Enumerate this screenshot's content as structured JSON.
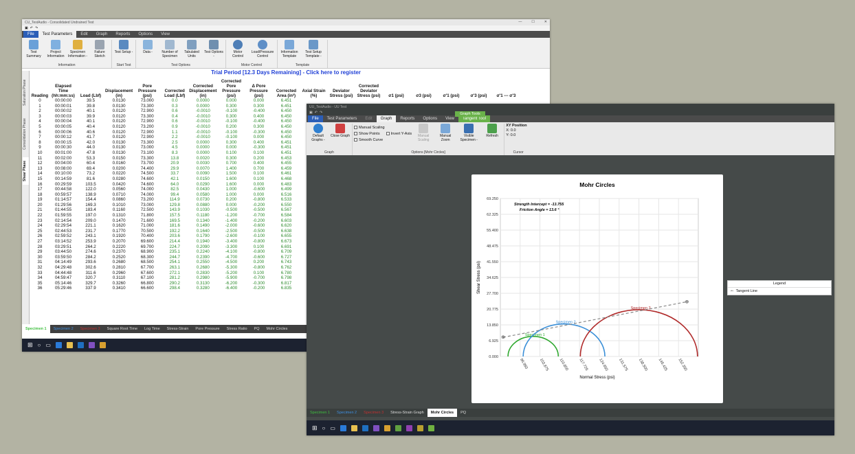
{
  "win1": {
    "title": "CU_TestAudio - Consolidated Undrained Test",
    "menu": [
      "File",
      "Test Parameters",
      "Edit",
      "Graph",
      "Reports",
      "Options",
      "View"
    ],
    "ribbon_groups": [
      {
        "label": "Information",
        "buttons": [
          "Test Summary",
          "Project Information",
          "Specimen Information -",
          "Failure Sketch"
        ]
      },
      {
        "label": "Start Test",
        "buttons": [
          "Test Setup -"
        ]
      },
      {
        "label": "Test Options",
        "buttons": [
          "Data -",
          "Number of Specimen",
          "Tabulated Units",
          "Test Options -"
        ]
      },
      {
        "label": "Motor Control",
        "buttons": [
          "Motor Control",
          "Load/Pressure Control"
        ]
      },
      {
        "label": "Template",
        "buttons": [
          "Information Template",
          "Test Setup Template -"
        ]
      }
    ],
    "trial_text": "Trial Period [12.3 Days Remaining] - Click here to register",
    "side_tabs": [
      "Saturation Phase",
      "Consolidation Phase",
      "Shear Phase"
    ],
    "columns": [
      "Reading",
      "Elapsed Time (hh:mm:ss)",
      "Load (Lbf)",
      "Displacement (in)",
      "Pore Pressure (psi)",
      "Corrected Load (Lbf)",
      "Corrected Displacement (in)",
      "Corrected Pore Pressure (psi)",
      "Δ Pore Pressure (psi)",
      "Corrected Area (in²)",
      "Axial Strain (%)",
      "Deviator Stress (psi)",
      "Corrected Deviator Stress (psi)",
      "σ1 (psi)",
      "σ3 (psi)",
      "σ'1 (psi)",
      "σ'3 (psi)",
      "σ'1 --- σ'3"
    ],
    "rows": [
      [
        "0",
        "00:00:00",
        "39.5",
        "0.0130",
        "73.000",
        "0.0",
        "0.0000",
        "0.000",
        "0.000",
        "6.451"
      ],
      [
        "1",
        "00:00:01",
        "39.8",
        "0.0130",
        "73.300",
        "0.3",
        "0.0000",
        "0.300",
        "0.300",
        "6.451"
      ],
      [
        "2",
        "00:00:02",
        "40.1",
        "0.0120",
        "72.900",
        "0.6",
        "-0.0010",
        "-0.100",
        "-0.400",
        "6.450"
      ],
      [
        "3",
        "00:00:03",
        "39.9",
        "0.0120",
        "73.300",
        "0.4",
        "-0.0010",
        "0.300",
        "0.400",
        "6.450"
      ],
      [
        "4",
        "00:00:04",
        "40.1",
        "0.0120",
        "72.900",
        "0.6",
        "-0.0010",
        "-0.100",
        "-0.400",
        "6.450"
      ],
      [
        "5",
        "00:00:05",
        "40.4",
        "0.0120",
        "73.200",
        "0.9",
        "-0.0010",
        "0.200",
        "0.300",
        "6.450"
      ],
      [
        "6",
        "00:00:06",
        "40.6",
        "0.0120",
        "72.900",
        "1.1",
        "-0.0010",
        "-0.100",
        "-0.300",
        "6.450"
      ],
      [
        "7",
        "00:00:12",
        "41.7",
        "0.0120",
        "72.900",
        "2.2",
        "-0.0010",
        "-0.100",
        "0.000",
        "6.450"
      ],
      [
        "8",
        "00:00:15",
        "42.0",
        "0.0130",
        "73.300",
        "2.5",
        "0.0000",
        "0.300",
        "0.400",
        "6.451"
      ],
      [
        "9",
        "00:00:30",
        "44.0",
        "0.0130",
        "73.000",
        "4.5",
        "0.0000",
        "0.000",
        "-0.300",
        "6.451"
      ],
      [
        "10",
        "00:01:00",
        "47.8",
        "0.0130",
        "73.100",
        "8.3",
        "0.0000",
        "0.100",
        "0.100",
        "6.451"
      ],
      [
        "11",
        "00:02:00",
        "53.3",
        "0.0150",
        "73.300",
        "13.8",
        "0.0020",
        "0.300",
        "0.200",
        "6.453"
      ],
      [
        "12",
        "00:04:00",
        "60.4",
        "0.0160",
        "73.700",
        "20.9",
        "0.0030",
        "0.700",
        "0.400",
        "6.455"
      ],
      [
        "13",
        "00:08:00",
        "69.4",
        "0.0200",
        "74.400",
        "29.9",
        "0.0070",
        "1.400",
        "0.700",
        "6.459"
      ],
      [
        "14",
        "00:10:00",
        "73.2",
        "0.0220",
        "74.500",
        "33.7",
        "0.0090",
        "1.500",
        "0.100",
        "6.461"
      ],
      [
        "15",
        "00:14:59",
        "81.6",
        "0.0280",
        "74.600",
        "42.1",
        "0.0150",
        "1.600",
        "0.100",
        "6.468"
      ],
      [
        "16",
        "00:29:59",
        "103.5",
        "0.0420",
        "74.600",
        "64.0",
        "0.0290",
        "1.600",
        "0.000",
        "6.483"
      ],
      [
        "17",
        "00:44:58",
        "122.0",
        "0.0560",
        "74.000",
        "82.5",
        "0.0430",
        "1.000",
        "-0.600",
        "6.499"
      ],
      [
        "18",
        "00:59:57",
        "138.9",
        "0.0710",
        "74.000",
        "99.4",
        "0.0580",
        "1.000",
        "0.000",
        "6.516"
      ],
      [
        "19",
        "01:14:57",
        "154.4",
        "0.0860",
        "73.200",
        "114.9",
        "0.0730",
        "0.200",
        "-0.800",
        "6.533"
      ],
      [
        "20",
        "01:29:56",
        "169.3",
        "0.1010",
        "73.000",
        "129.8",
        "0.0880",
        "0.000",
        "-0.200",
        "6.550"
      ],
      [
        "21",
        "01:44:55",
        "183.4",
        "0.1160",
        "72.500",
        "143.9",
        "0.1030",
        "-0.500",
        "-0.500",
        "6.567"
      ],
      [
        "22",
        "01:59:55",
        "197.0",
        "0.1310",
        "71.800",
        "157.5",
        "0.1180",
        "-1.200",
        "-0.700",
        "6.584"
      ],
      [
        "23",
        "02:14:54",
        "209.0",
        "0.1470",
        "71.600",
        "169.5",
        "0.1340",
        "-1.400",
        "-0.200",
        "6.603"
      ],
      [
        "24",
        "02:29:54",
        "221.1",
        "0.1620",
        "71.000",
        "181.6",
        "0.1490",
        "-2.000",
        "-0.600",
        "6.620"
      ],
      [
        "25",
        "02:44:53",
        "231.7",
        "0.1770",
        "70.500",
        "192.2",
        "0.1640",
        "-2.500",
        "-0.500",
        "6.638"
      ],
      [
        "26",
        "02:59:52",
        "243.1",
        "0.1920",
        "70.400",
        "203.6",
        "0.1790",
        "-2.600",
        "-0.100",
        "6.655"
      ],
      [
        "27",
        "03:14:52",
        "253.9",
        "0.2070",
        "69.600",
        "214.4",
        "0.1940",
        "-3.400",
        "-0.800",
        "6.673"
      ],
      [
        "28",
        "03:29:51",
        "264.2",
        "0.2220",
        "69.700",
        "224.7",
        "0.2090",
        "-3.300",
        "0.100",
        "6.691"
      ],
      [
        "29",
        "03:44:50",
        "274.6",
        "0.2370",
        "68.900",
        "235.1",
        "0.2240",
        "-4.100",
        "-0.800",
        "6.709"
      ],
      [
        "30",
        "03:59:50",
        "284.2",
        "0.2520",
        "68.300",
        "244.7",
        "0.2390",
        "-4.700",
        "-0.600",
        "6.727"
      ],
      [
        "31",
        "04:14:49",
        "293.6",
        "0.2680",
        "68.500",
        "254.1",
        "0.2550",
        "-4.500",
        "0.200",
        "6.743"
      ],
      [
        "32",
        "04:29:48",
        "302.6",
        "0.2810",
        "67.700",
        "263.1",
        "0.2680",
        "-5.300",
        "-0.800",
        "6.762"
      ],
      [
        "33",
        "04:44:48",
        "311.6",
        "0.2960",
        "67.600",
        "272.1",
        "0.2830",
        "-5.200",
        "0.100",
        "6.780"
      ],
      [
        "34",
        "04:59:47",
        "320.7",
        "0.3110",
        "67.100",
        "281.2",
        "0.2980",
        "-5.900",
        "-0.700",
        "6.798"
      ],
      [
        "35",
        "05:14:46",
        "329.7",
        "0.3260",
        "66.800",
        "290.2",
        "0.3130",
        "-6.200",
        "-0.300",
        "6.817"
      ],
      [
        "36",
        "05:29:46",
        "337.9",
        "0.3410",
        "66.600",
        "298.4",
        "0.3280",
        "-6.400",
        "-0.200",
        "6.835"
      ]
    ],
    "bottom_tabs": [
      "Specimen 1",
      "Specimen 2",
      "Specimen 3",
      "Square Root Time",
      "Log Time",
      "Stress-Strain",
      "Pore Pressure",
      "Stress Ratio",
      "PQ",
      "Mohr Circles"
    ],
    "tab_colors": {
      "s1": "#3fbf3f",
      "s2": "#3f8fe0",
      "s3": "#c03030"
    }
  },
  "win2": {
    "title": "UU_TestAudio - UU Test",
    "context_tab": "Graph Tools",
    "menu": [
      "File",
      "Test Parameters",
      "Edit",
      "Graph",
      "Reports",
      "Options",
      "View",
      "Tangent Tool"
    ],
    "ribbon": {
      "graph_group": "Graph",
      "default_graphs": "Default Graphs -",
      "close_graph": "Close Graph",
      "options_group": "Options [Mohr Circles]",
      "manual_scaling_chk": "Manual Scaling",
      "show_points_chk": "Show Points",
      "smooth_curve_chk": "Smooth Curve",
      "invert_y_chk": "Invert Y-Axis",
      "manual_scaling_btn": "Manual Scaling",
      "manual_zoom_btn": "Manual Zoom",
      "visible_specimen_btn": "Visible Specimen -",
      "refresh_btn": "Refresh",
      "cursor_group": "Cursor",
      "xy_label": "XY Position",
      "x_val": "X: 0.0",
      "y_val": "Y: 0.0"
    },
    "bottom_tabs": [
      "Specimen 1",
      "Specimen 2",
      "Specimen 3",
      "Stress-Strain Graph",
      "Mohr Circles",
      "PQ"
    ],
    "legend_title": "Legend",
    "legend_item": "Tangent Line"
  },
  "chart_data": {
    "type": "scatter",
    "title": "Mohr Circles",
    "xlabel": "Normal Stress (psi)",
    "ylabel": "Shear Stress (psi)",
    "annotation_1": "Strength Intercept = -13.755",
    "annotation_2": "Friction Angle = 13.6 °",
    "yticks": [
      "0.000",
      "6.925",
      "13.850",
      "20.775",
      "27.700",
      "34.625",
      "41.550",
      "48.475",
      "55.400",
      "62.325",
      "69.250"
    ],
    "xticks": [
      "96.950",
      "103.875",
      "110.800",
      "117.725",
      "124.650",
      "131.575",
      "138.500",
      "145.425",
      "152.350"
    ],
    "xlim": [
      90.025,
      159.275
    ],
    "ylim": [
      0,
      69.25
    ],
    "circles": [
      {
        "name": "Specimen 1",
        "center": 101.5,
        "radius": 8.8,
        "color": "#2fa82f"
      },
      {
        "name": "Specimen 2",
        "center": 112.3,
        "radius": 14.3,
        "color": "#3a8fd8"
      },
      {
        "name": "Specimen 3",
        "center": 138.5,
        "radius": 20.5,
        "color": "#b02a2a"
      }
    ],
    "tangent_line": {
      "name": "Tangent Line",
      "x": [
        91.0,
        155.3
      ],
      "y": [
        8.4,
        24.0
      ],
      "color": "#888888"
    }
  }
}
